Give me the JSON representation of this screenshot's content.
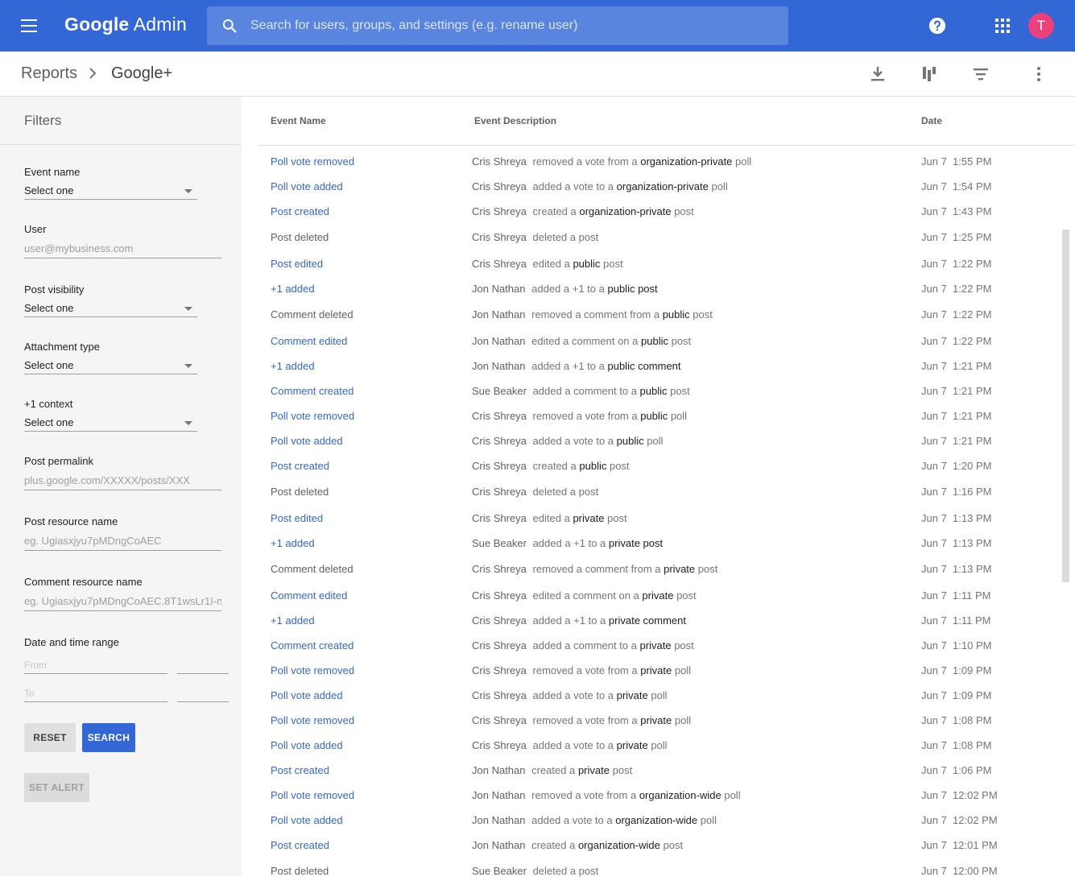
{
  "topbar": {
    "brand_google": "Google",
    "brand_admin": "Admin",
    "search_placeholder": "Search for users, groups, and settings (e.g. rename user)",
    "avatar_letter": "T",
    "accent_color": "#3367d6",
    "icons": [
      "menu-icon",
      "search-icon",
      "help-icon",
      "apps-icon"
    ]
  },
  "breadcrumb": {
    "parent": "Reports",
    "current": "Google+"
  },
  "toolbar": {
    "icons": [
      "download-icon",
      "column-chart-icon",
      "filter-icon",
      "more-vert-icon"
    ]
  },
  "filters": {
    "title": "Filters",
    "event_name": {
      "label": "Event name",
      "value": "Select one"
    },
    "user": {
      "label": "User",
      "placeholder": "user@mybusiness.com"
    },
    "post_visibility": {
      "label": "Post visibility",
      "value": "Select one"
    },
    "attachment_type": {
      "label": "Attachment type",
      "value": "Select one"
    },
    "plus_one_context": {
      "label": "+1 context",
      "value": "Select one"
    },
    "post_permalink": {
      "label": "Post permalink",
      "placeholder": "plus.google.com/XXXXX/posts/XXX"
    },
    "post_resource": {
      "label": "Post resource name",
      "placeholder": "eg. Ugiasxjyu7pMDngCoAEC"
    },
    "comment_resource": {
      "label": "Comment resource name",
      "placeholder": "eg. Ugiasxjyu7pMDngCoAEC.8T1wsLr1I-n8"
    },
    "date_range": {
      "label": "Date and time range",
      "from_placeholder": "From",
      "to_placeholder": "To"
    },
    "reset_label": "RESET",
    "search_label": "SEARCH",
    "alert_label": "SET ALERT"
  },
  "table": {
    "headers": {
      "name": "Event Name",
      "desc": "Event Description",
      "date": "Date"
    },
    "rows": [
      {
        "name": "Poll vote removed",
        "link": true,
        "actor": "Cris Shreya",
        "verb": "removed a vote from a",
        "obj": "organization-private",
        "suffix": "poll",
        "date": "Jun 7  1:55 PM"
      },
      {
        "name": "Poll vote added",
        "link": true,
        "actor": "Cris Shreya",
        "verb": "added a vote to a",
        "obj": "organization-private",
        "suffix": "poll",
        "date": "Jun 7  1:54 PM"
      },
      {
        "name": "Post created",
        "link": true,
        "actor": "Cris Shreya",
        "verb": "created a",
        "obj": "organization-private",
        "suffix": "post",
        "date": "Jun 7  1:43 PM"
      },
      {
        "name": "Post deleted",
        "link": false,
        "actor": "Cris Shreya",
        "verb": "deleted a post",
        "obj": "",
        "suffix": "",
        "date": "Jun 7  1:25 PM"
      },
      {
        "name": "Post edited",
        "link": true,
        "actor": "Cris Shreya",
        "verb": "edited a",
        "obj": "public",
        "suffix": "post",
        "date": "Jun 7  1:22 PM"
      },
      {
        "name": "+1 added",
        "link": true,
        "actor": "Jon Nathan",
        "verb": "added a +1 to a",
        "obj": "public post",
        "suffix": "",
        "date": "Jun 7  1:22 PM"
      },
      {
        "name": "Comment deleted",
        "link": false,
        "actor": "Jon Nathan",
        "verb": "removed a comment from a",
        "obj": "public",
        "suffix": "post",
        "date": "Jun 7  1:22 PM"
      },
      {
        "name": "Comment edited",
        "link": true,
        "actor": "Jon Nathan",
        "verb": "edited a comment on a",
        "obj": "public",
        "suffix": "post",
        "date": "Jun 7  1:22 PM"
      },
      {
        "name": "+1 added",
        "link": true,
        "actor": "Jon Nathan",
        "verb": "added a +1 to a",
        "obj": "public comment",
        "suffix": "",
        "date": "Jun 7  1:21 PM"
      },
      {
        "name": "Comment created",
        "link": true,
        "actor": "Sue Beaker",
        "verb": "added a comment to a",
        "obj": "public",
        "suffix": "post",
        "date": "Jun 7  1:21 PM"
      },
      {
        "name": "Poll vote removed",
        "link": true,
        "actor": "Cris Shreya",
        "verb": "removed a vote from a",
        "obj": "public",
        "suffix": "poll",
        "date": "Jun 7  1:21 PM"
      },
      {
        "name": "Poll vote added",
        "link": true,
        "actor": "Cris Shreya",
        "verb": "added a vote to a",
        "obj": "public",
        "suffix": "poll",
        "date": "Jun 7  1:21 PM"
      },
      {
        "name": "Post created",
        "link": true,
        "actor": "Cris Shreya",
        "verb": "created a",
        "obj": "public",
        "suffix": "post",
        "date": "Jun 7  1:20 PM"
      },
      {
        "name": "Post deleted",
        "link": false,
        "actor": "Cris Shreya",
        "verb": "deleted a post",
        "obj": "",
        "suffix": "",
        "date": "Jun 7  1:16 PM"
      },
      {
        "name": "Post edited",
        "link": true,
        "actor": "Cris Shreya",
        "verb": "edited a",
        "obj": "private",
        "suffix": "post",
        "date": "Jun 7  1:13 PM"
      },
      {
        "name": "+1 added",
        "link": true,
        "actor": "Sue Beaker",
        "verb": "added a +1 to a",
        "obj": "private post",
        "suffix": "",
        "date": "Jun 7  1:13 PM"
      },
      {
        "name": "Comment deleted",
        "link": false,
        "actor": "Cris Shreya",
        "verb": "removed a comment from a",
        "obj": "private",
        "suffix": "post",
        "date": "Jun 7  1:13 PM"
      },
      {
        "name": "Comment edited",
        "link": true,
        "actor": "Cris Shreya",
        "verb": "edited a comment on a",
        "obj": "private",
        "suffix": "post",
        "date": "Jun 7  1:11 PM"
      },
      {
        "name": "+1 added",
        "link": true,
        "actor": "Cris Shreya",
        "verb": "added a +1 to a",
        "obj": "private comment",
        "suffix": "",
        "date": "Jun 7  1:11 PM"
      },
      {
        "name": "Comment created",
        "link": true,
        "actor": "Cris Shreya",
        "verb": "added a comment to a",
        "obj": "private",
        "suffix": "post",
        "date": "Jun 7  1:10 PM"
      },
      {
        "name": "Poll vote removed",
        "link": true,
        "actor": "Cris Shreya",
        "verb": "removed a vote from a",
        "obj": "private",
        "suffix": "poll",
        "date": "Jun 7  1:09 PM"
      },
      {
        "name": "Poll vote added",
        "link": true,
        "actor": "Cris Shreya",
        "verb": "added a vote to a",
        "obj": "private",
        "suffix": "poll",
        "date": "Jun 7  1:09 PM"
      },
      {
        "name": "Poll vote removed",
        "link": true,
        "actor": "Cris Shreya",
        "verb": "removed a vote from a",
        "obj": "private",
        "suffix": "poll",
        "date": "Jun 7  1:08 PM"
      },
      {
        "name": "Poll vote added",
        "link": true,
        "actor": "Cris Shreya",
        "verb": "added a vote to a",
        "obj": "private",
        "suffix": "poll",
        "date": "Jun 7  1:08 PM"
      },
      {
        "name": "Post created",
        "link": true,
        "actor": "Jon Nathan",
        "verb": "created a",
        "obj": "private",
        "suffix": "post",
        "date": "Jun 7  1:06 PM"
      },
      {
        "name": "Poll vote removed",
        "link": true,
        "actor": "Jon Nathan",
        "verb": "removed a vote from a",
        "obj": "organization-wide",
        "suffix": "poll",
        "date": "Jun 7  12:02 PM"
      },
      {
        "name": "Poll vote added",
        "link": true,
        "actor": "Jon Nathan",
        "verb": "added a vote to a",
        "obj": "organization-wide",
        "suffix": "poll",
        "date": "Jun 7  12:02 PM"
      },
      {
        "name": "Post created",
        "link": true,
        "actor": "Jon Nathan",
        "verb": "created a",
        "obj": "organization-wide",
        "suffix": "post",
        "date": "Jun 7  12:01 PM"
      },
      {
        "name": "Post deleted",
        "link": false,
        "actor": "Sue Beaker",
        "verb": "deleted a post",
        "obj": "",
        "suffix": "",
        "date": "Jun 7  12:00 PM"
      }
    ]
  }
}
